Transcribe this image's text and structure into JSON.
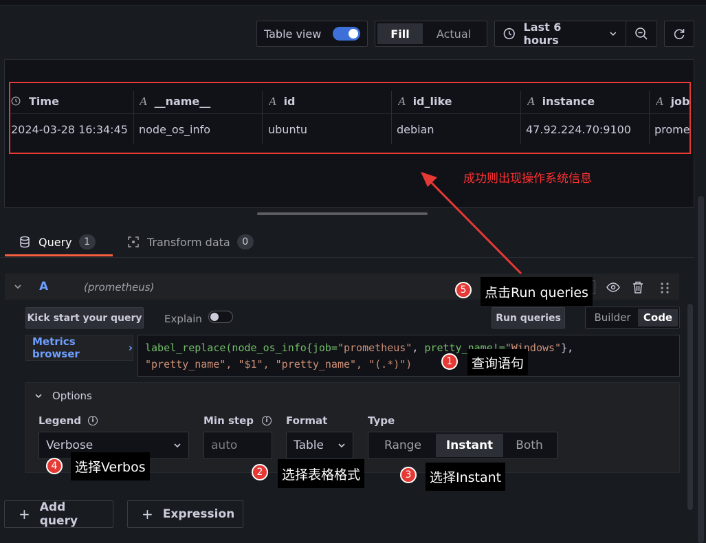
{
  "toolbar": {
    "table_view_label": "Table view",
    "fill_label": "Fill",
    "actual_label": "Actual",
    "time_range_label": "Last 6 hours"
  },
  "table": {
    "columns": [
      {
        "label": "Time",
        "type_icon": "clock-icon"
      },
      {
        "label": "__name__",
        "type_icon": "string-type-icon"
      },
      {
        "label": "id",
        "type_icon": "string-type-icon"
      },
      {
        "label": "id_like",
        "type_icon": "string-type-icon"
      },
      {
        "label": "instance",
        "type_icon": "string-type-icon"
      },
      {
        "label": "job",
        "type_icon": "string-type-icon"
      }
    ],
    "rows": [
      [
        "2024-03-28 16:34:45",
        "node_os_info",
        "ubuntu",
        "debian",
        "47.92.224.70:9100",
        "prometheus"
      ]
    ]
  },
  "annotations": {
    "success_text": "成功则出现操作系统信息",
    "step1_num": "1",
    "step1_text": "查询语句",
    "step2_num": "2",
    "step2_text": "选择表格格式",
    "step3_num": "3",
    "step3_text": "选择Instant",
    "step4_num": "4",
    "step4_text": "选择Verbos",
    "step5_num": "5",
    "step5_text": "点击Run queries"
  },
  "tabs": [
    {
      "label": "Query",
      "count": "1"
    },
    {
      "label": "Transform data",
      "count": "0"
    }
  ],
  "query": {
    "ref_id": "A",
    "datasource": "(prometheus)",
    "kick_start_label": "Kick start your query",
    "explain_label": "Explain",
    "run_queries_label": "Run queries",
    "builder_label": "Builder",
    "code_label": "Code",
    "metrics_browser_label": "Metrics browser",
    "expr_line1_parts": [
      "label_replace(node_os_info{",
      "job=",
      "\"prometheus\"",
      ", ",
      "pretty_name!=",
      "\"Windows\"",
      "},"
    ],
    "expr_line2": "\"pretty_name\", \"$1\", \"pretty_name\", \"(.*)\")"
  },
  "options": {
    "header_label": "Options",
    "legend_label": "Legend",
    "legend_value": "Verbose",
    "min_step_label": "Min step",
    "min_step_placeholder": "auto",
    "format_label": "Format",
    "format_value": "Table",
    "type_label": "Type",
    "type_options": [
      "Range",
      "Instant",
      "Both"
    ],
    "type_selected": "Instant"
  },
  "bottom": {
    "add_query_label": "Add query",
    "expression_label": "Expression"
  },
  "colors": {
    "accent_blue": "#3d71d9",
    "annotation_red": "#e53935",
    "tab_underline": "#f55f3e",
    "query_ref": "#6e9fff"
  }
}
